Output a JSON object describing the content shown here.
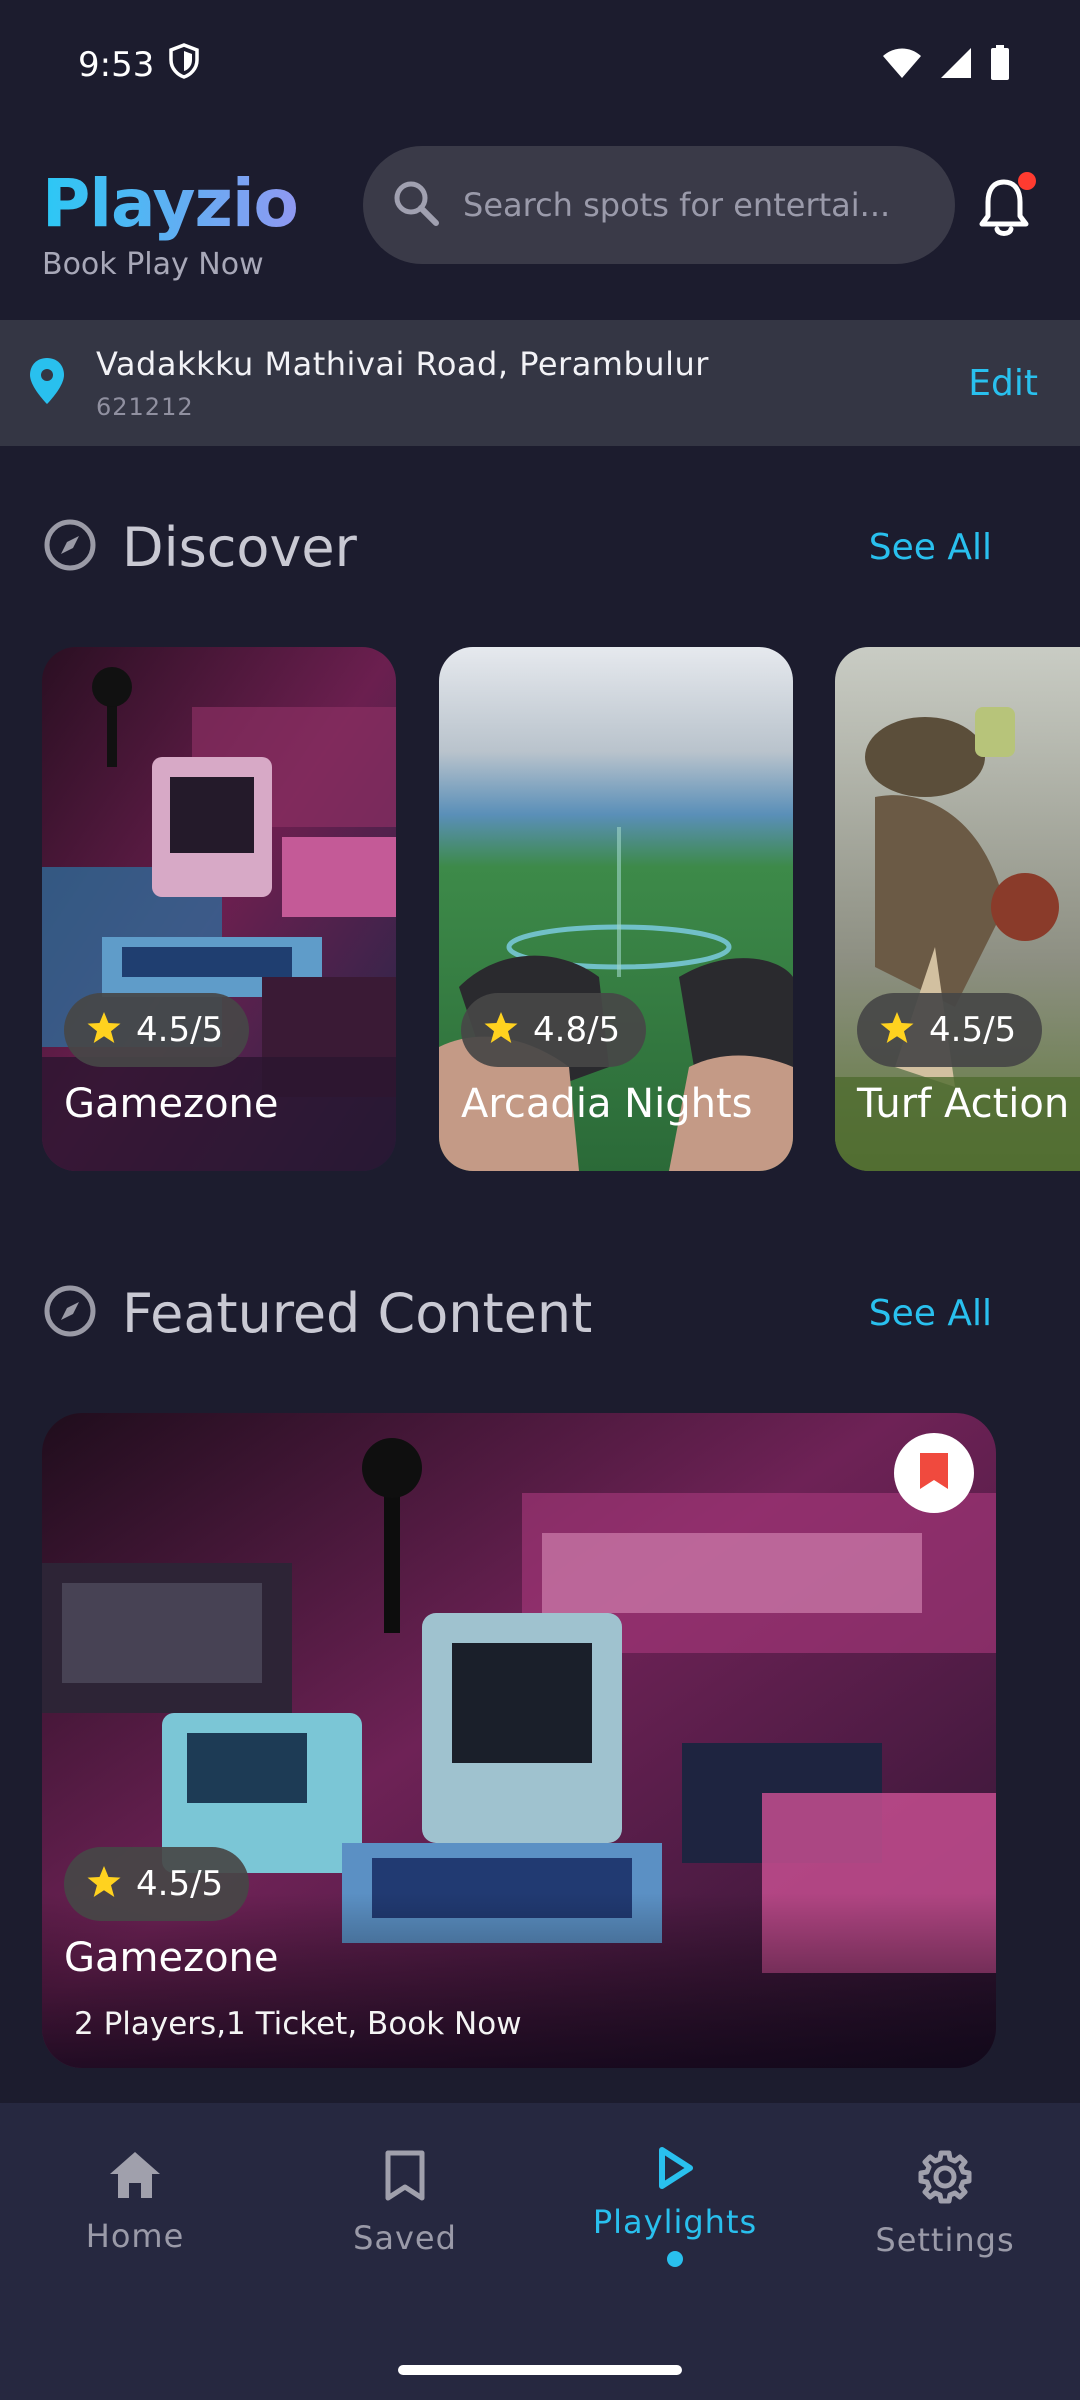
{
  "status_bar": {
    "time": "9:53"
  },
  "header": {
    "brand_name": "Playzio",
    "brand_tagline": "Book Play Now",
    "search_placeholder": "Search spots for entertai..."
  },
  "location": {
    "address": "Vadakkku Mathivai Road, Perambulur",
    "pincode": "621212",
    "edit_label": "Edit"
  },
  "discover": {
    "title": "Discover",
    "see_all": "See All",
    "cards": [
      {
        "title": "Gamezone",
        "rating": "4.5/5"
      },
      {
        "title": "Arcadia Nights",
        "rating": "4.8/5"
      },
      {
        "title": "Turf Action",
        "rating": "4.5/5"
      }
    ]
  },
  "featured": {
    "title": "Featured Content",
    "see_all": "See All",
    "card": {
      "title": "Gamezone",
      "rating": "4.5/5",
      "subtitle": "2 Players,1 Ticket, Book Now"
    }
  },
  "bottom_nav": {
    "items": [
      {
        "label": "Home",
        "icon": "home-icon"
      },
      {
        "label": "Saved",
        "icon": "bookmark-icon"
      },
      {
        "label": "Playlights",
        "icon": "play-icon",
        "active": true
      },
      {
        "label": "Settings",
        "icon": "gear-icon"
      }
    ]
  },
  "colors": {
    "background": "#1c1c2e",
    "accent": "#29c0ee",
    "nav_background": "#262840",
    "location_bar": "#343644",
    "star": "#ffd21f",
    "bookmark_red": "#f04a3e"
  }
}
